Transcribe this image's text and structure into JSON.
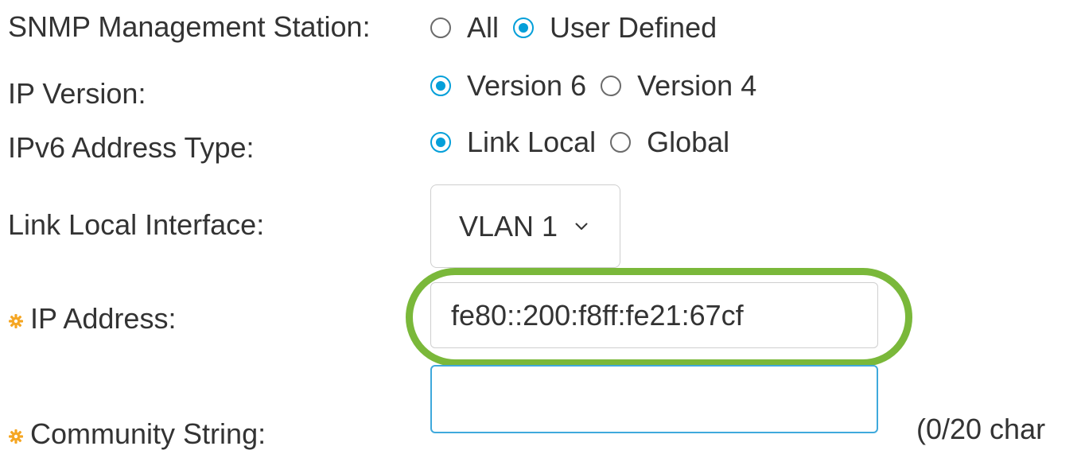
{
  "snmp_station": {
    "label": "SNMP Management Station:",
    "options": [
      {
        "label": "All",
        "selected": false
      },
      {
        "label": "User Defined",
        "selected": true
      }
    ]
  },
  "ip_version": {
    "label": "IP Version:",
    "options": [
      {
        "label": "Version 6",
        "selected": true
      },
      {
        "label": "Version 4",
        "selected": false
      }
    ]
  },
  "ipv6_type": {
    "label": "IPv6 Address Type:",
    "options": [
      {
        "label": "Link Local",
        "selected": true
      },
      {
        "label": "Global",
        "selected": false
      }
    ]
  },
  "link_local_interface": {
    "label": "Link Local Interface:",
    "value": "VLAN 1"
  },
  "ip_address": {
    "label": "IP Address:",
    "value": "fe80::200:f8ff:fe21:67cf"
  },
  "community_string": {
    "label": "Community String:",
    "value": "",
    "counter": "(0/20 char"
  },
  "colors": {
    "accent": "#049fd9",
    "highlight": "#7ab83a",
    "required_icon": "#f5a623"
  }
}
